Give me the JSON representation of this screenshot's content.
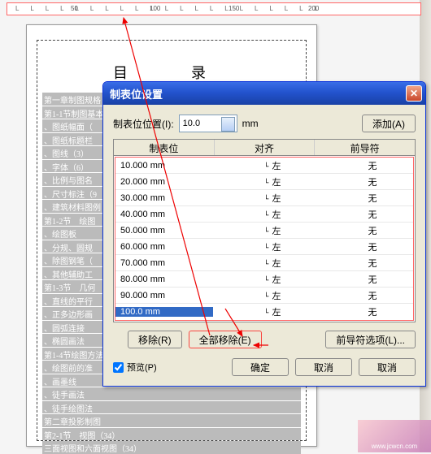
{
  "ruler": {
    "labels": [
      "50",
      "100",
      "150",
      "200"
    ]
  },
  "doc": {
    "title": "目　录",
    "lines": [
      "第一章制图规格",
      "第1-1节制图基本",
      "、图纸幅面（",
      "、图纸标题栏",
      "、图线（3）",
      "、字体（6）",
      "、比例与图名",
      "、尺寸标注（9",
      "、建筑材料图例",
      "第1-2节　绘图",
      "、绘图板",
      "、分规、圆规",
      "、除图钢笔（",
      "、其他辅助工",
      "第1-3节　几何",
      "、直线的平行",
      "、正多边形画",
      "、圆弧连接",
      "、椭圆画法",
      "第1-4节绘图方法",
      "、绘图前的准",
      "、画墨线",
      "、徒手画法",
      "、徒手绘图法",
      "第二章投影制图",
      "第2-1节　视图（34）",
      "三面视图和六面视图（34）"
    ]
  },
  "dialog": {
    "title": "制表位设置",
    "pos_label": "制表位位置(I):",
    "pos_value": "10.0",
    "unit": "mm",
    "add_label": "添加(A)",
    "headers": {
      "pos": "制表位",
      "align": "对齐",
      "leader": "前导符"
    },
    "rows": [
      {
        "pos": "10.000 mm",
        "align": "左",
        "leader": "无"
      },
      {
        "pos": "20.000 mm",
        "align": "左",
        "leader": "无"
      },
      {
        "pos": "30.000 mm",
        "align": "左",
        "leader": "无"
      },
      {
        "pos": "40.000 mm",
        "align": "左",
        "leader": "无"
      },
      {
        "pos": "50.000 mm",
        "align": "左",
        "leader": "无"
      },
      {
        "pos": "60.000 mm",
        "align": "左",
        "leader": "无"
      },
      {
        "pos": "70.000 mm",
        "align": "左",
        "leader": "无"
      },
      {
        "pos": "80.000 mm",
        "align": "左",
        "leader": "无"
      },
      {
        "pos": "90.000 mm",
        "align": "左",
        "leader": "无"
      },
      {
        "pos": "100.0 mm",
        "align": "左",
        "leader": "无",
        "selected": true
      }
    ],
    "remove_label": "移除(R)",
    "remove_all_label": "全部移除(E)",
    "leader_opts_label": "前导符选项(L)...",
    "preview_label": "预览(P)",
    "ok_label": "确定",
    "cancel_label": "取消",
    "cancel2_label": "取消"
  },
  "watermark": "www.jcwcn.com"
}
